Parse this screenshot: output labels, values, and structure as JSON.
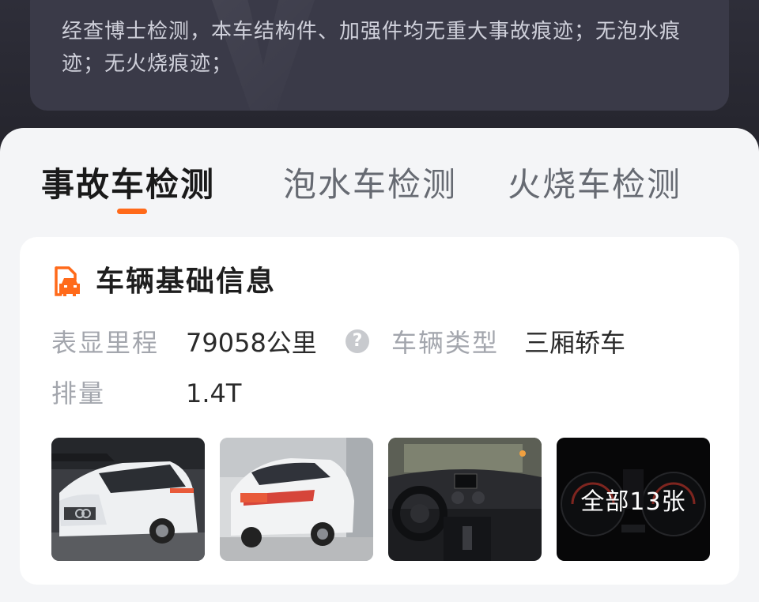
{
  "summary": {
    "text": "经查博士检测，本车结构件、加强件均无重大事故痕迹；无泡水痕迹；无火烧痕迹；"
  },
  "tabs": [
    {
      "label": "事故车检测",
      "active": true
    },
    {
      "label": "泡水车检测",
      "active": false
    },
    {
      "label": "火烧车检测",
      "active": false
    }
  ],
  "basic_info": {
    "title": "车辆基础信息",
    "fields": {
      "mileage_label": "表显里程",
      "mileage_value": "79058公里",
      "type_label": "车辆类型",
      "type_value": "三厢轿车",
      "displacement_label": "排量",
      "displacement_value": "1.4T"
    },
    "photos": [
      {
        "name": "front-exterior-photo"
      },
      {
        "name": "rear-exterior-photo"
      },
      {
        "name": "interior-dashboard-photo"
      },
      {
        "name": "instrument-cluster-photo",
        "overlay": "全部13张"
      }
    ]
  },
  "colors": {
    "accent": "#ff6a1a",
    "background": "#24242c",
    "sheet": "#f4f5f7"
  }
}
